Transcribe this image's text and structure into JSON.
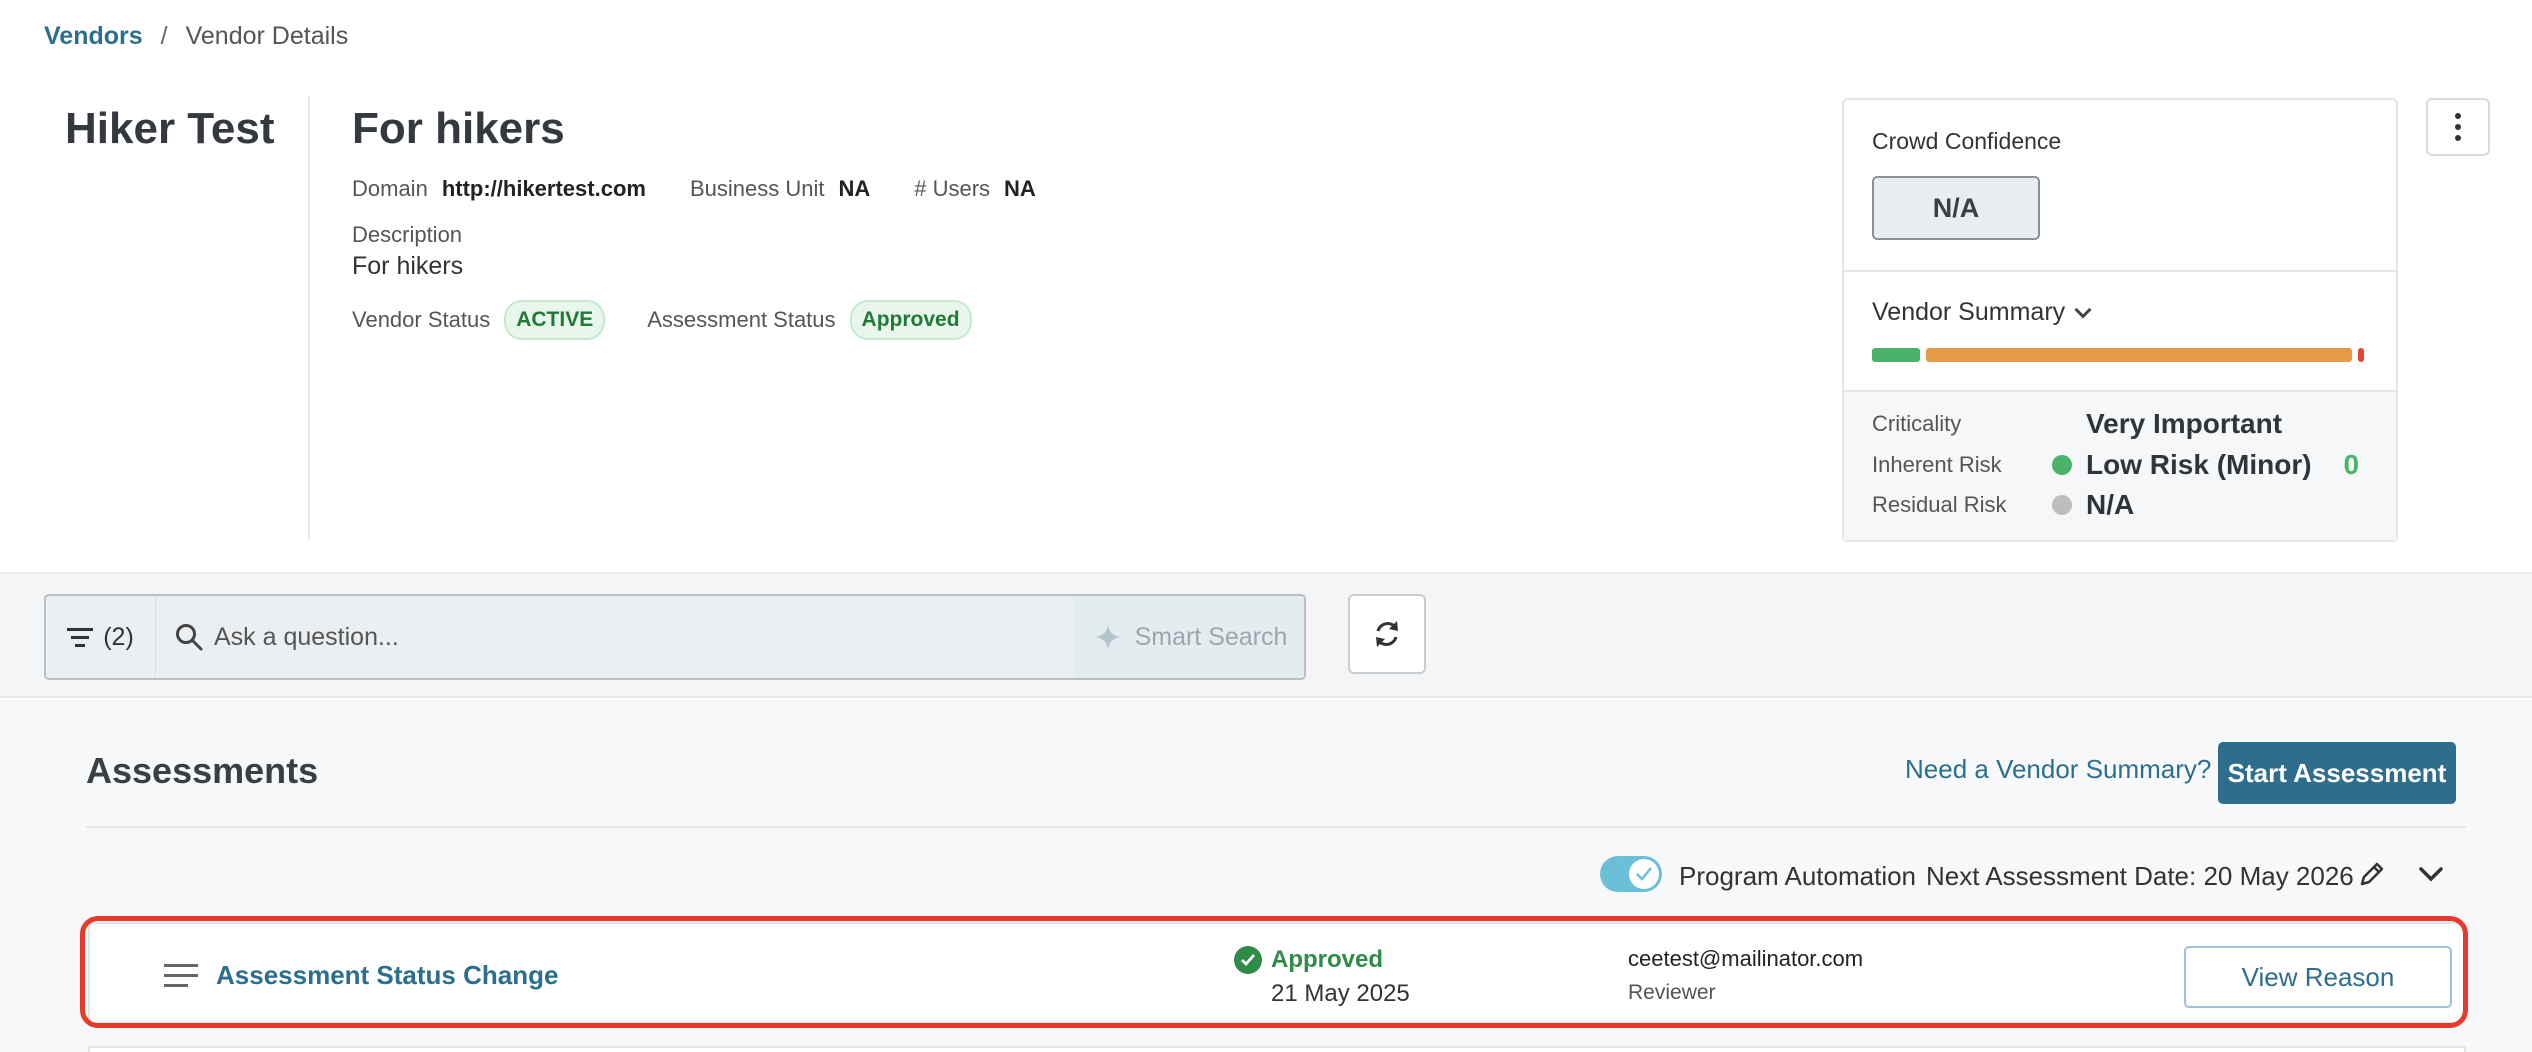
{
  "breadcrumb": {
    "root": "Vendors",
    "separator": "/",
    "current": "Vendor Details"
  },
  "vendor": {
    "name": "Hiker Test",
    "title": "For hikers",
    "domain_label": "Domain",
    "domain_value": "http://hikertest.com",
    "business_unit_label": "Business Unit",
    "business_unit_value": "NA",
    "users_label": "# Users",
    "users_value": "NA",
    "description_label": "Description",
    "description_value": "For hikers",
    "vendor_status_label": "Vendor Status",
    "vendor_status_value": "ACTIVE",
    "assessment_status_label": "Assessment Status",
    "assessment_status_value": "Approved"
  },
  "summary_card": {
    "crowd_confidence_label": "Crowd Confidence",
    "crowd_confidence_value": "N/A",
    "vendor_summary_label": "Vendor Summary",
    "criticality_label": "Criticality",
    "criticality_value": "Very Important",
    "inherent_risk_label": "Inherent Risk",
    "inherent_risk_value": "Low Risk (Minor)",
    "inherent_risk_score": "0",
    "residual_risk_label": "Residual Risk",
    "residual_risk_value": "N/A",
    "colors": {
      "low": "#4bb26a",
      "medium": "#e59a45",
      "high": "#e0452f",
      "na": "#bdbdbd"
    }
  },
  "search": {
    "filter_count": "(2)",
    "placeholder": "Ask a question...",
    "smart_search_label": "Smart Search"
  },
  "assessments": {
    "title": "Assessments",
    "need_summary_link": "Need a Vendor Summary?",
    "start_button": "Start Assessment",
    "program_automation_label": "Program Automation",
    "program_automation_on": true,
    "next_assessment_date": "Next Assessment Date: 20 May 2026",
    "rows": [
      {
        "title": "Assessment Status Change",
        "status": "Approved",
        "date": "21 May 2025",
        "reviewer_email": "ceetest@mailinator.com",
        "reviewer_role": "Reviewer",
        "action": "View Reason"
      }
    ]
  },
  "icons": [
    "filter-icon",
    "search-icon",
    "sparkle-icon",
    "refresh-icon",
    "kebab-menu-icon",
    "chevron-down-icon",
    "pencil-icon",
    "check-circle-icon",
    "list-icon"
  ]
}
